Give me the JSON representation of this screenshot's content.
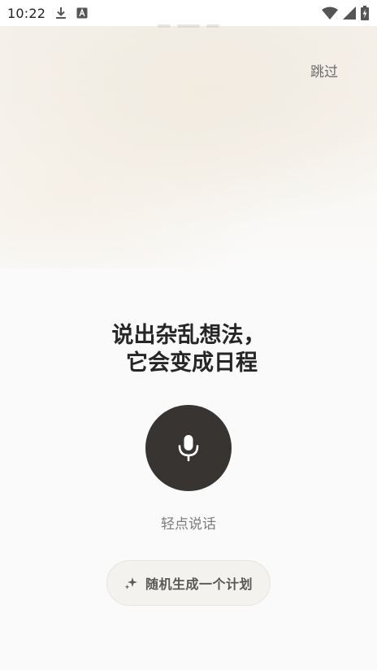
{
  "status_bar": {
    "time": "10:22",
    "left_icons": [
      "download-icon",
      "a-badge-icon"
    ],
    "right_icons": [
      "wifi-icon",
      "cellular-signal-icon",
      "battery-charging-icon"
    ]
  },
  "onboarding": {
    "skip_label": "跳过",
    "headline_line1": "说出杂乱想法，",
    "headline_line2": "它会变成日程",
    "mic_icon": "microphone-icon",
    "hint": "轻点说话",
    "random_plan_label": "随机生成一个计划",
    "random_plan_icon": "sparkles-icon"
  },
  "colors": {
    "mic_button_bg": "#373432",
    "background": "#fafafa",
    "pill_bg": "#f3f2ef"
  }
}
